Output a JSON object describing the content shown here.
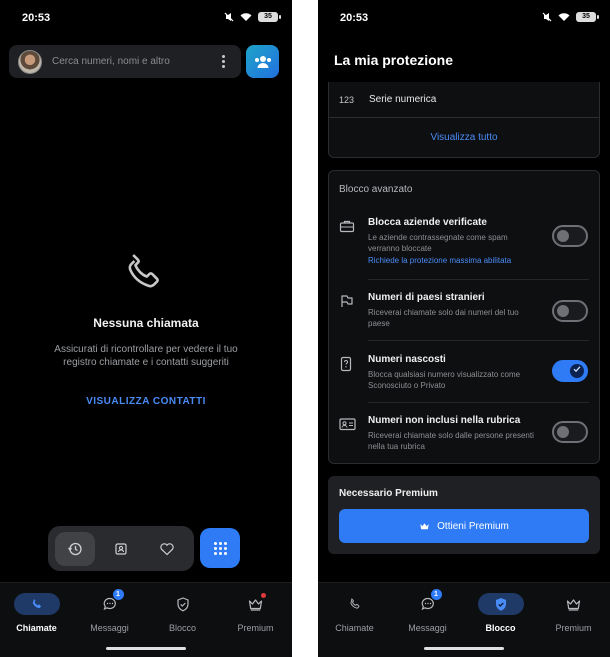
{
  "status": {
    "time": "20:53",
    "battery": "35"
  },
  "calls_screen": {
    "search_placeholder": "Cerca numeri, nomi e altro",
    "empty_title": "Nessuna chiamata",
    "empty_subtitle": "Assicurati di ricontrollare per vedere il tuo registro chiamate e i contatti suggeriti",
    "view_contacts": "VISUALIZZA CONTATTI"
  },
  "protection_screen": {
    "title": "La mia protezione",
    "serie": {
      "icon_text": "123",
      "label": "Serie numerica"
    },
    "view_all": "Visualizza tutto",
    "advanced": {
      "section_label": "Blocco avanzato",
      "rows": [
        {
          "title": "Blocca aziende verificate",
          "desc": "Le aziende contrassegnate come spam verranno bloccate",
          "link": "Richiede la protezione massima abilitata",
          "enabled": false,
          "icon": "briefcase-icon"
        },
        {
          "title": "Numeri di paesi stranieri",
          "desc": "Riceverai chiamate solo dai numeri del tuo paese",
          "enabled": false,
          "icon": "flag-icon"
        },
        {
          "title": "Numeri nascosti",
          "desc": "Blocca qualsiasi numero visualizzato come Sconosciuto o Privato",
          "enabled": true,
          "icon": "question-phone-icon"
        },
        {
          "title": "Numeri non inclusi nella rubrica",
          "desc": "Riceverai chiamate solo dalle persone presenti nella tua rubrica",
          "enabled": false,
          "icon": "contact-card-icon"
        }
      ]
    },
    "premium": {
      "label": "Necessario Premium",
      "button": "Ottieni Premium"
    }
  },
  "nav": {
    "items": [
      "Chiamate",
      "Messaggi",
      "Blocco",
      "Premium"
    ],
    "messages_badge": "1"
  },
  "colors": {
    "accent": "#2f7bf6",
    "background": "#000000",
    "surface": "#1f2023"
  }
}
